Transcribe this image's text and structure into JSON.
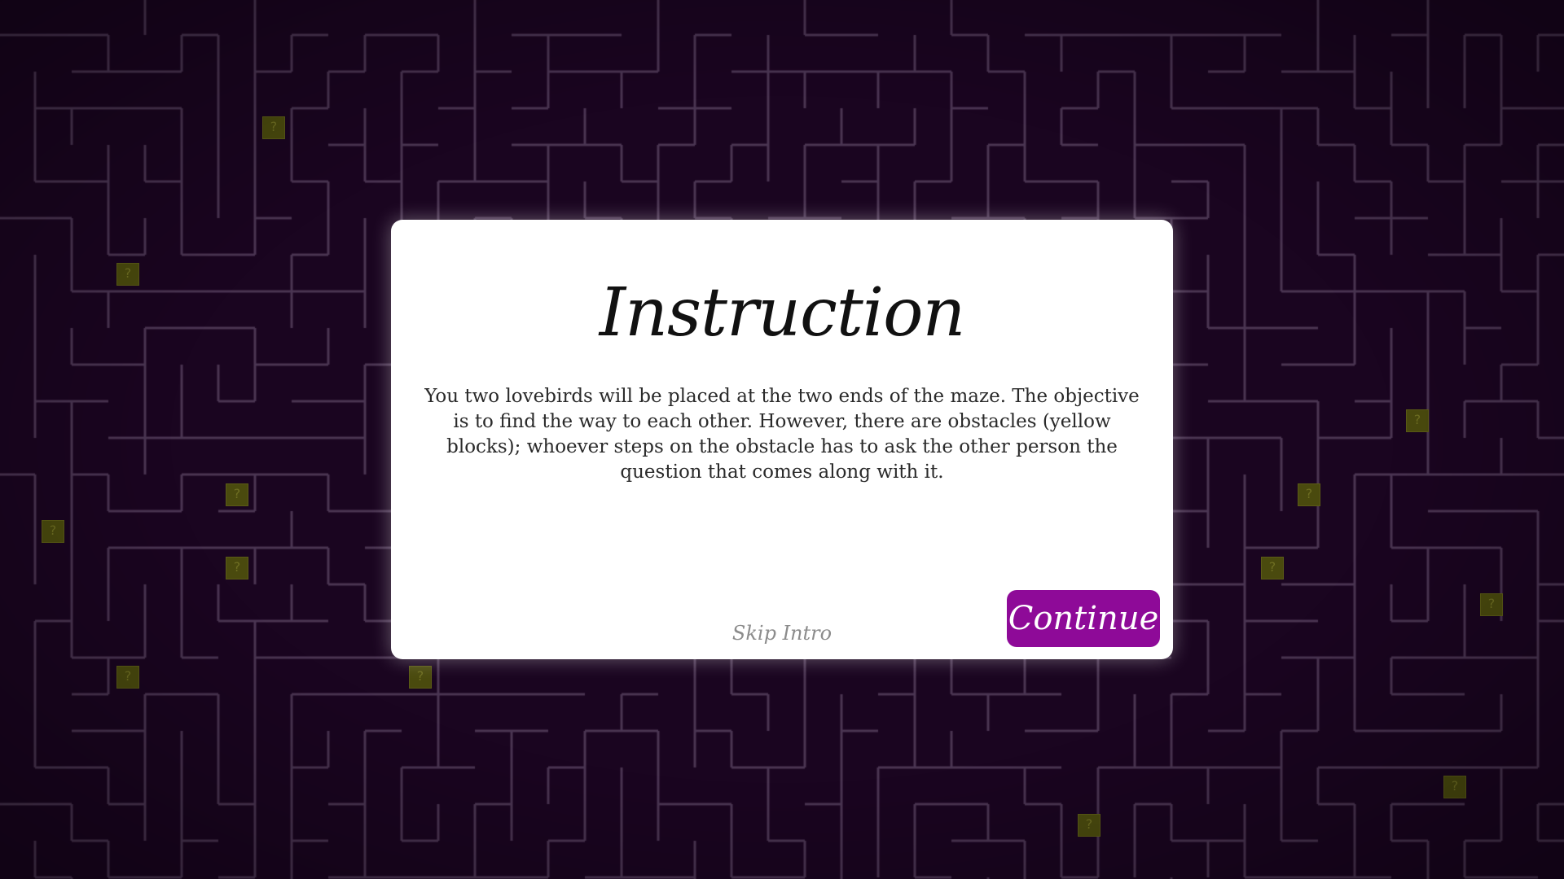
{
  "modal": {
    "title": "Instruction",
    "body": "You two lovebirds will be placed at the two ends of the maze. The objective is to find the way to each other. However, there are obstacles (yellow blocks); whoever steps on the obstacle has to ask the other person the question that comes along with it.",
    "skip_label": "Skip Intro",
    "continue_label": "Continue"
  },
  "maze": {
    "obstacle_label": "?",
    "obstacle_count": 17
  },
  "colors": {
    "background": "#1a0520",
    "maze_wall": "#4a3552",
    "obstacle": "#4a4a0e",
    "modal_background": "#ffffff",
    "accent": "#8e0a98",
    "skip_text": "#8c8c8c"
  }
}
